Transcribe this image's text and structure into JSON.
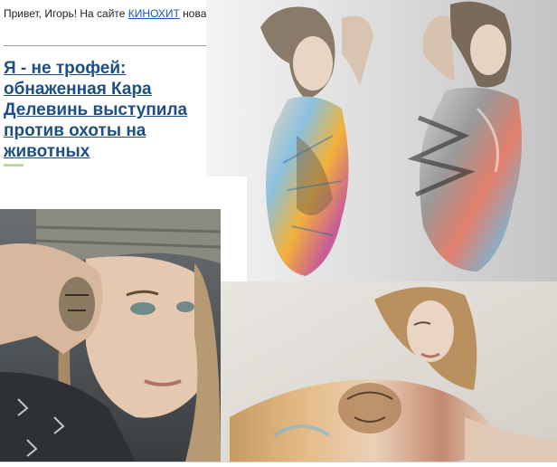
{
  "email": {
    "greeting_prefix": "Привет, Игорь! На сайте ",
    "site_link": "КИНОХИТ",
    "greeting_suffix": " новая тема:",
    "headline": "Я - не трофей: обнаженная Кара Делевинь выступила против охоты на животных",
    "colors": {
      "link": "#1a55b8",
      "headline": "#1d4f86"
    }
  },
  "images": [
    {
      "name": "photo-standing"
    },
    {
      "name": "photo-hand"
    },
    {
      "name": "photo-lying"
    }
  ]
}
